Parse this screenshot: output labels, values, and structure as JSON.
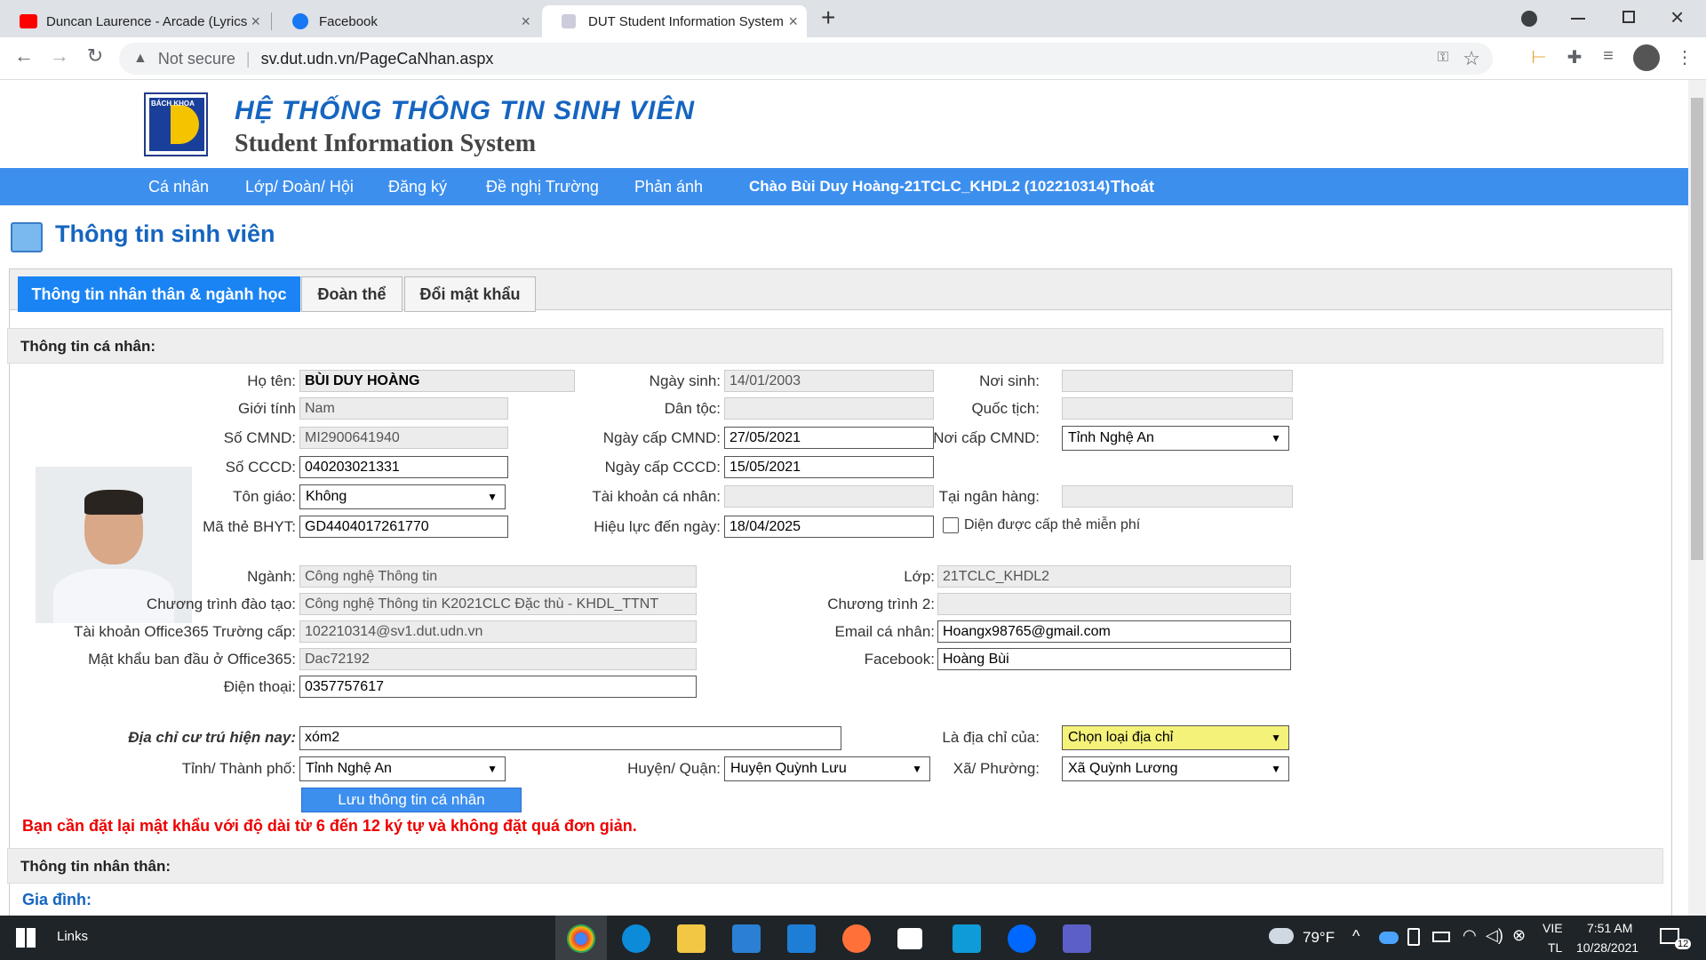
{
  "browser": {
    "tabs": [
      {
        "title": "Duncan Laurence - Arcade (Lyrics",
        "close": "×"
      },
      {
        "title": "Facebook",
        "close": "×"
      },
      {
        "title": "DUT Student Information System",
        "close": "×"
      }
    ],
    "new_tab": "+",
    "security": "Not secure",
    "url": "sv.dut.udn.vn/PageCaNhan.aspx"
  },
  "site": {
    "logo_text": "BÁCH KHOA",
    "title_vi": "HỆ THỐNG THÔNG TIN SINH VIÊN",
    "title_en": "Student Information System"
  },
  "menu": {
    "items": [
      "Cá nhân",
      "Lớp/ Đoàn/ Hội",
      "Đăng ký",
      "Đề nghị Trường",
      "Phản ánh"
    ],
    "greeting": "Chào Bùi Duy Hoàng-21TCLC_KHDL2 (102210314)",
    "logout": "Thoát"
  },
  "page_title": "Thông tin sinh viên",
  "tabs": [
    "Thông tin nhân thân & ngành học",
    "Đoàn thể",
    "Đổi mật khẩu"
  ],
  "section1": "Thông tin cá nhân:",
  "personal": {
    "ho_ten": {
      "label": "Họ tên:",
      "value": "BÙI DUY HOÀNG"
    },
    "gioi_tinh": {
      "label": "Giới tính",
      "value": "Nam"
    },
    "so_cmnd": {
      "label": "Số CMND:",
      "value": "MI2900641940"
    },
    "so_cccd": {
      "label": "Số CCCD:",
      "value": "040203021331"
    },
    "ton_giao": {
      "label": "Tôn giáo:",
      "value": "Không"
    },
    "bhyt": {
      "label": "Mã thẻ BHYT:",
      "value": "GD4404017261770"
    },
    "ngay_sinh": {
      "label": "Ngày sinh:",
      "value": "14/01/2003"
    },
    "dan_toc": {
      "label": "Dân tộc:",
      "value": ""
    },
    "ngay_cap_cmnd": {
      "label": "Ngày cấp CMND:",
      "value": "27/05/2021"
    },
    "ngay_cap_cccd": {
      "label": "Ngày cấp CCCD:",
      "value": "15/05/2021"
    },
    "tai_khoan": {
      "label": "Tài khoản cá nhân:",
      "value": ""
    },
    "hieu_luc": {
      "label": "Hiệu lực đến ngày:",
      "value": "18/04/2025"
    },
    "noi_sinh": {
      "label": "Nơi sinh:",
      "value": ""
    },
    "quoc_tich": {
      "label": "Quốc tịch:",
      "value": ""
    },
    "noi_cap_cmnd": {
      "label": "Nơi cấp CMND:",
      "value": "Tỉnh Nghệ An"
    },
    "ngan_hang": {
      "label": "Tại ngân hàng:",
      "value": ""
    },
    "mien_phi": "Diện được cấp thẻ miễn phí"
  },
  "academic": {
    "nganh": {
      "label": "Ngành:",
      "value": "Công nghệ Thông tin"
    },
    "ctdt": {
      "label": "Chương trình đào tạo:",
      "value": "Công nghệ Thông tin K2021CLC Đặc thù - KHDL_TTNT"
    },
    "office365": {
      "label": "Tài khoản Office365 Trường cấp:",
      "value": "102210314@sv1.dut.udn.vn"
    },
    "mat_khau": {
      "label": "Mật khẩu ban đầu ở Office365:",
      "value": "Dac72192"
    },
    "dien_thoai": {
      "label": "Điện thoại:",
      "value": "0357757617"
    },
    "lop": {
      "label": "Lớp:",
      "value": "21TCLC_KHDL2"
    },
    "ct2": {
      "label": "Chương trình 2:",
      "value": ""
    },
    "email": {
      "label": "Email cá nhân:",
      "value": "Hoangx98765@gmail.com"
    },
    "facebook": {
      "label": "Facebook:",
      "value": "Hoàng Bùi"
    }
  },
  "address": {
    "dia_chi": {
      "label": "Địa chỉ cư trú hiện nay:",
      "value": "xóm2"
    },
    "la_dia_chi": {
      "label": "Là địa chỉ của:",
      "value": "Chọn loại địa chỉ"
    },
    "tinh": {
      "label": "Tỉnh/ Thành phố:",
      "value": "Tỉnh Nghệ An"
    },
    "huyen": {
      "label": "Huyện/ Quận:",
      "value": "Huyện Quỳnh Lưu"
    },
    "xa": {
      "label": "Xã/ Phường:",
      "value": "Xã Quỳnh Lương"
    }
  },
  "save_button": "Lưu thông tin cá nhân",
  "warning": "Bạn cần đặt lại mật khẩu với độ dài từ 6 đến 12 ký tự và không đặt quá đơn giản.",
  "section2": "Thông tin nhân thân:",
  "family": "Gia đình:",
  "taskbar": {
    "links": "Links",
    "weather": "79°F",
    "lang1": "VIE",
    "lang2": "TL",
    "time": "7:51 AM",
    "date": "10/28/2021",
    "notif": "12"
  },
  "colors": {
    "accent": "#3d8fee",
    "tab_active": "#1a84f5",
    "warning": "#ee0000",
    "title": "#1565c0"
  }
}
